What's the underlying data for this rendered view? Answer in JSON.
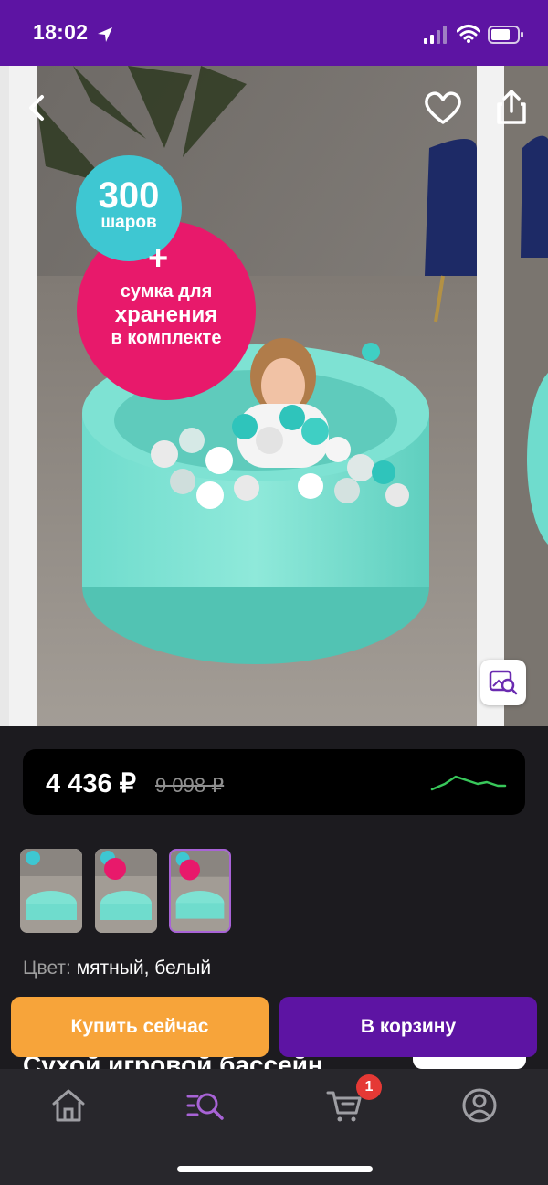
{
  "status_bar": {
    "time": "18:02"
  },
  "gallery": {
    "promo": {
      "count": "300",
      "count_unit": "шаров",
      "plus": "+",
      "line1": "сумка для",
      "line2": "хранения",
      "line3": "в комплекте"
    },
    "photo_count": 3,
    "active_photo": 3
  },
  "price": {
    "current": "4 436 ₽",
    "old": "9 098 ₽",
    "trend_color": "#38c75a"
  },
  "product": {
    "color_label": "Цвет:",
    "color_value": "мятный, белый",
    "title_peek": "Сухой игровой бассейн"
  },
  "actions": {
    "buy_now": "Купить сейчас",
    "add_to_cart": "В корзину"
  },
  "tab_bar": {
    "items": [
      {
        "name": "home",
        "icon": "home-icon"
      },
      {
        "name": "catalog",
        "icon": "catalog-search-icon",
        "active": true
      },
      {
        "name": "cart",
        "icon": "cart-icon",
        "badge": "1"
      },
      {
        "name": "profile",
        "icon": "profile-icon"
      }
    ]
  },
  "colors": {
    "brand": "#5d14a3",
    "accent_orange": "#f7a43a",
    "active_tab": "#a863d6"
  }
}
